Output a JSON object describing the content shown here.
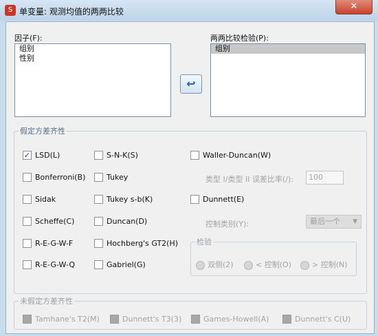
{
  "window": {
    "title": "单变量: 观测均值的两两比较",
    "close_glyph": "✕",
    "icon_glyph": "S"
  },
  "factors": {
    "label": "因子(F):",
    "items": [
      "组别",
      "性别"
    ]
  },
  "move_button": {
    "glyph": "↩"
  },
  "posthoc": {
    "label": "两两比较检验(P):",
    "items": [
      "组别"
    ]
  },
  "equal_var": {
    "legend": "假定方差齐性",
    "options": {
      "lsd": {
        "label": "LSD(L)",
        "checked": true
      },
      "snk": {
        "label": "S-N-K(S)"
      },
      "waller": {
        "label": "Waller-Duncan(W)"
      },
      "bonferroni": {
        "label": "Bonferroni(B)"
      },
      "tukey": {
        "label": "Tukey"
      },
      "sidak": {
        "label": "Sidak"
      },
      "tukeyb": {
        "label": "Tukey s-b(K)"
      },
      "dunnett": {
        "label": "Dunnett(E)"
      },
      "scheffe": {
        "label": "Scheffe(C)"
      },
      "duncan": {
        "label": "Duncan(D)"
      },
      "regwf": {
        "label": "R-E-G-W-F"
      },
      "hochberg": {
        "label": "Hochberg's GT2(H)"
      },
      "regwq": {
        "label": "R-E-G-W-Q"
      },
      "gabriel": {
        "label": "Gabriel(G)"
      }
    },
    "error_ratio_label": "类型 I/类型 II 误差比率(/):",
    "error_ratio_value": "100",
    "control_label": "控制类别(Y):",
    "control_value": "最后一个",
    "test": {
      "legend": "检验",
      "two_sided": "双侧(2)",
      "less_control": "< 控制(O)",
      "greater_control": "> 控制(N)"
    }
  },
  "unequal_var": {
    "legend": "未假定方差齐性",
    "options": {
      "tamhane": "Tamhane's T2(M)",
      "dunnett_t3": "Dunnett's T3(3)",
      "games_howell": "Games-Howell(A)",
      "dunnett_c": "Dunnett's C(U)"
    }
  }
}
